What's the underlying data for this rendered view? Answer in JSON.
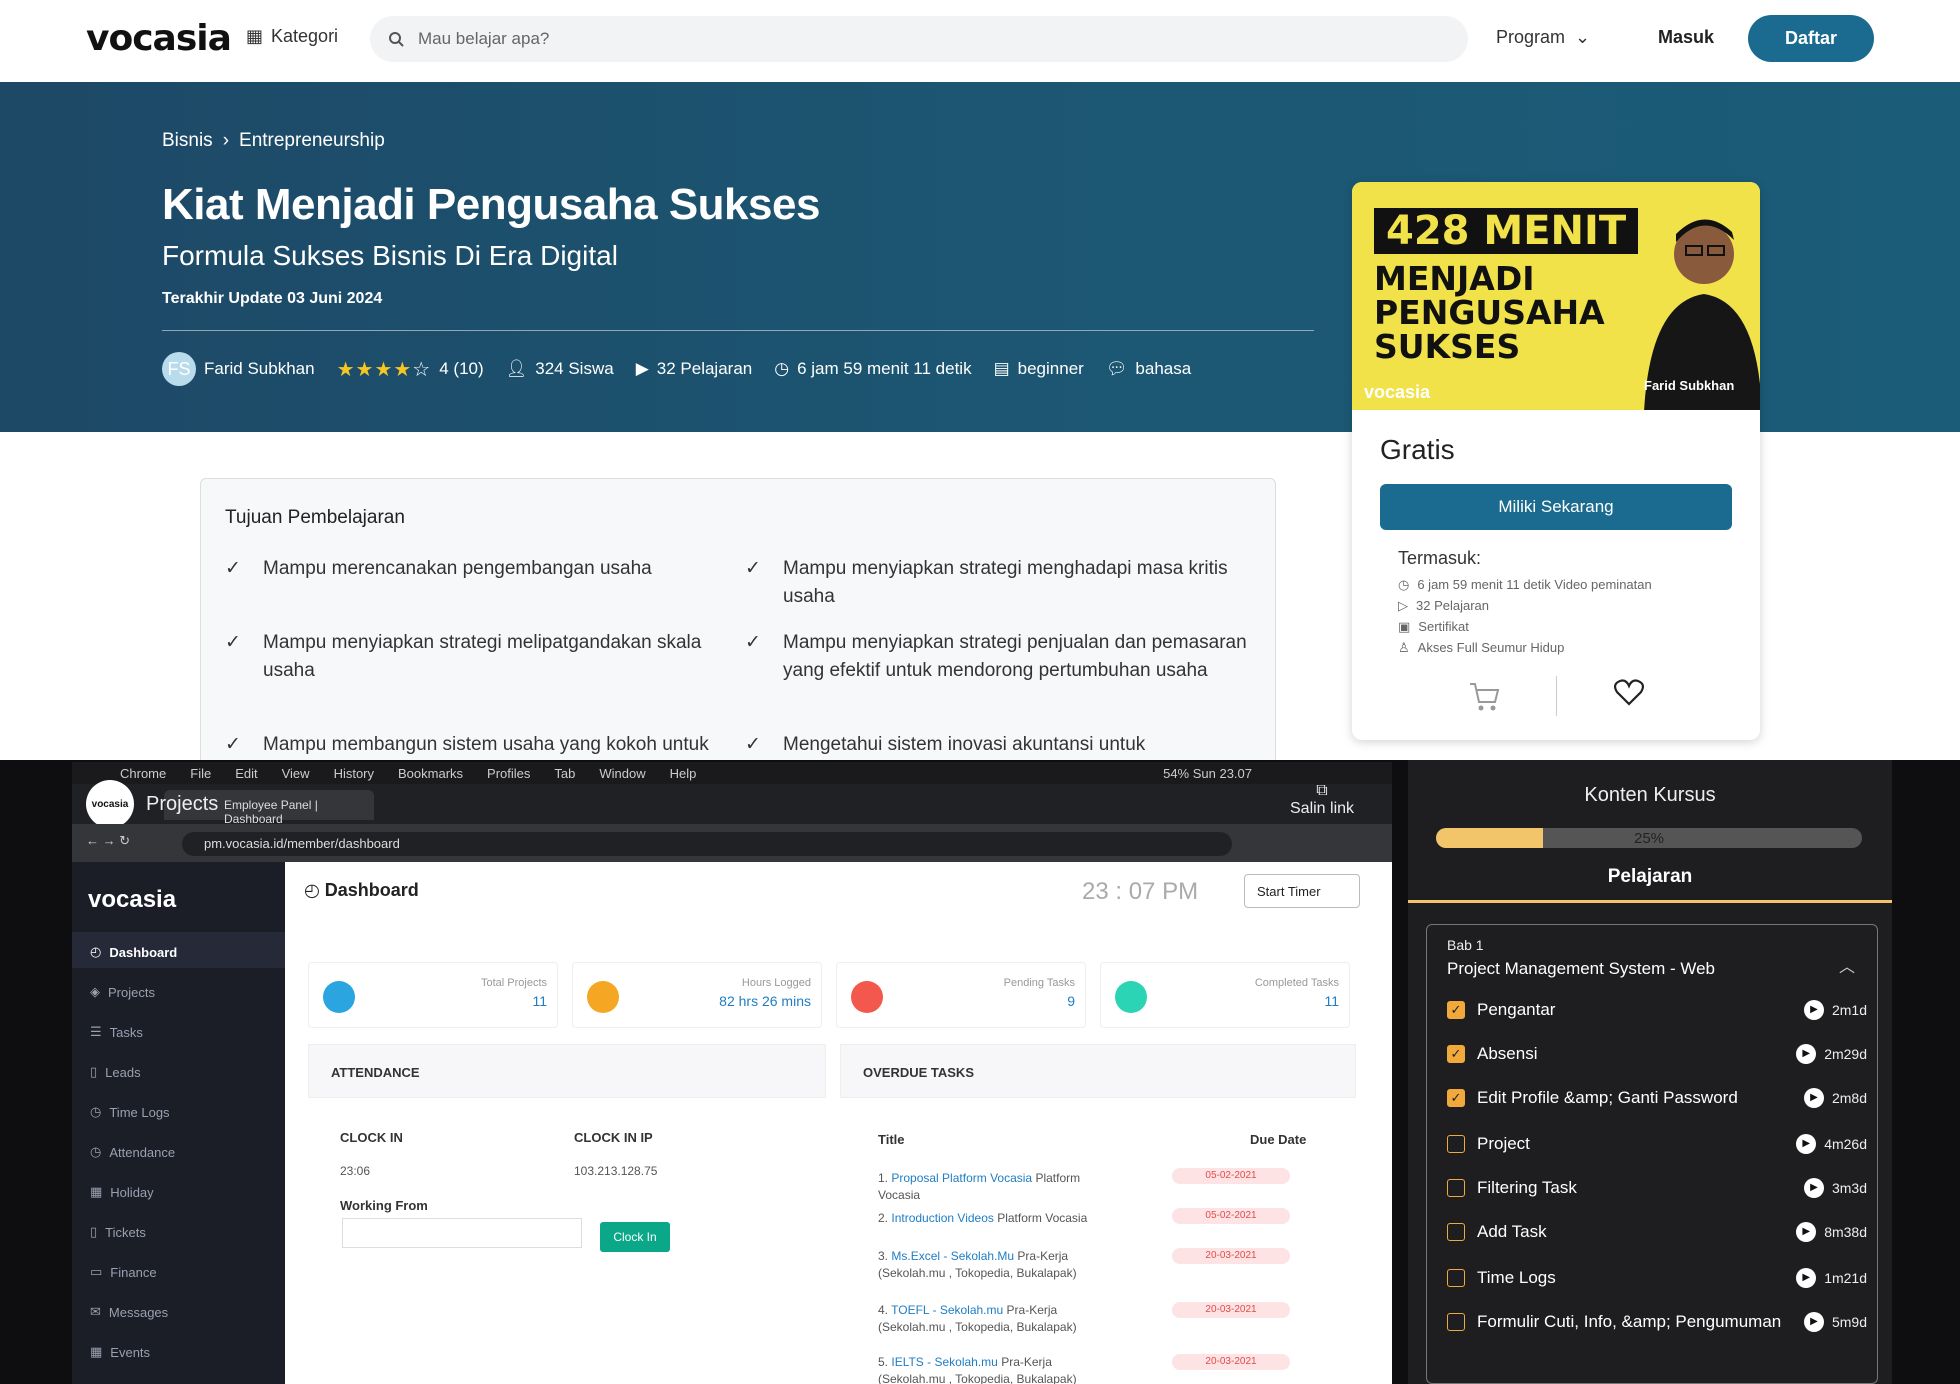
{
  "nav": {
    "logo_main": "vocasia",
    "kategori": "Kategori",
    "search_placeholder": "Mau belajar apa?",
    "program": "Program",
    "masuk": "Masuk",
    "daftar": "Daftar"
  },
  "hero": {
    "crumb1": "Bisnis",
    "crumb2": "Entrepreneurship",
    "title": "Kiat Menjadi Pengusaha Sukses",
    "subtitle": "Formula Sukses Bisnis Di Era Digital",
    "updated": "Terakhir Update 03 Juni 2024",
    "author_initials": "FS",
    "author": "Farid Subkhan",
    "rating": "4 (10)",
    "students": "324 Siswa",
    "lessons": "32 Pelajaran",
    "duration": "6 jam 59 menit 11 detik",
    "level": "beginner",
    "language": "bahasa"
  },
  "card": {
    "thumb_line1": "428 MENIT",
    "thumb_line2": "MENJADI",
    "thumb_line3": "PENGUSAHA",
    "thumb_line4": "SUKSES",
    "thumb_logo": "vocasia",
    "thumb_name": "Farid Subkhan",
    "price": "Gratis",
    "buy": "Miliki Sekarang",
    "includes_title": "Termasuk:",
    "includes": [
      "6 jam 59 menit 11 detik Video peminatan",
      "32 Pelajaran",
      "Sertifikat",
      "Akses Full Seumur Hidup"
    ]
  },
  "objectives": {
    "title": "Tujuan Pembelajaran",
    "items": [
      "Mampu merencanakan pengembangan usaha",
      "Mampu menyiapkan strategi menghadapi masa kritis usaha",
      "Mampu menyiapkan strategi melipatgandakan skala usaha",
      "Mampu menyiapkan strategi penjualan dan pemasaran yang efektif untuk mendorong pertumbuhan usaha",
      "Mampu membangun sistem usaha yang kokoh untuk",
      "Mengetahui sistem inovasi akuntansi untuk"
    ]
  },
  "video": {
    "menubar": [
      "Chrome",
      "File",
      "Edit",
      "View",
      "History",
      "Bookmarks",
      "Profiles",
      "Tab",
      "Window",
      "Help"
    ],
    "menubar_right": "54%   Sun 23.07",
    "overlay_avatar": "vocasia",
    "overlay_title": "Projects",
    "salin": "Salin link",
    "tab_title": "Employee Panel | Dashboard",
    "url": "pm.vocasia.id/member/dashboard",
    "dash_logo": "vocasia",
    "sidebar": [
      "Dashboard",
      "Projects",
      "Tasks",
      "Leads",
      "Time Logs",
      "Attendance",
      "Holiday",
      "Tickets",
      "Finance",
      "Messages",
      "Events"
    ],
    "dash_title": "Dashboard",
    "clock": "23 : 07 PM",
    "start_timer": "Start Timer",
    "stats": [
      {
        "label": "Total Projects",
        "value": "11"
      },
      {
        "label": "Hours Logged",
        "value": "82 hrs 26 mins"
      },
      {
        "label": "Pending Tasks",
        "value": "9"
      },
      {
        "label": "Completed Tasks",
        "value": "11"
      }
    ],
    "attendance": "ATTENDANCE",
    "overdue": "OVERDUE TASKS",
    "clock_in_label": "CLOCK IN",
    "clock_in": "23:06",
    "clock_in_ip_label": "CLOCK IN IP",
    "clock_in_ip": "103.213.128.75",
    "working_from": "Working From",
    "clock_in_btn": "Clock In",
    "col_title": "Title",
    "col_due": "Due Date",
    "tasks": [
      {
        "num": "1.",
        "link": "Proposal Platform Vocasia",
        "rest": " Platform Vocasia",
        "due": "05-02-2021"
      },
      {
        "num": "2.",
        "link": "Introduction Videos",
        "rest": " Platform Vocasia",
        "due": "05-02-2021"
      },
      {
        "num": "3.",
        "link": "Ms.Excel - Sekolah.Mu",
        "rest": " Pra-Kerja (Sekolah.mu , Tokopedia, Bukalapak)",
        "due": "20-03-2021"
      },
      {
        "num": "4.",
        "link": "TOEFL - Sekolah.mu",
        "rest": " Pra-Kerja (Sekolah.mu , Tokopedia, Bukalapak)",
        "due": "20-03-2021"
      },
      {
        "num": "5.",
        "link": "IELTS - Sekolah.mu",
        "rest": " Pra-Kerja (Sekolah.mu , Tokopedia, Bukalapak)",
        "due": "20-03-2021"
      }
    ]
  },
  "konten": {
    "title": "Konten Kursus",
    "progress": 0.25,
    "progress_label": "25%",
    "tab": "Pelajaran",
    "bab_label": "Bab 1",
    "bab_name": "Project Management System - Web",
    "lessons": [
      {
        "name": "Pengantar",
        "dur": "2m1d",
        "done": true
      },
      {
        "name": "Absensi",
        "dur": "2m29d",
        "done": true
      },
      {
        "name": "Edit Profile &amp; Ganti Password",
        "dur": "2m8d",
        "done": true
      },
      {
        "name": "Project",
        "dur": "4m26d",
        "done": false
      },
      {
        "name": "Filtering Task",
        "dur": "3m3d",
        "done": false
      },
      {
        "name": "Add Task",
        "dur": "8m38d",
        "done": false
      },
      {
        "name": "Time Logs",
        "dur": "1m21d",
        "done": false
      },
      {
        "name": "Formulir Cuti, Info, &amp; Pengumuman",
        "dur": "5m9d",
        "done": false
      }
    ]
  }
}
